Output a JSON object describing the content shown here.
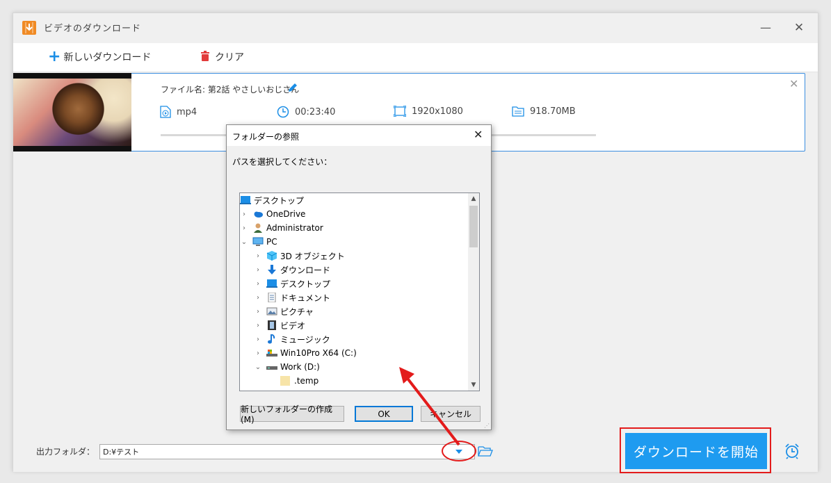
{
  "window": {
    "title": "ビデオのダウンロード",
    "minimize": "—",
    "close": "✕"
  },
  "toolbar": {
    "new_download_label": "新しいダウンロード",
    "clear_label": "クリア"
  },
  "download_item": {
    "file_name_label": "ファイル名: 第2話 やさしいおじさん",
    "format": "mp4",
    "duration": "00:23:40",
    "resolution": "1920x1080",
    "size": "918.70MB",
    "progress": 0.0
  },
  "bottom": {
    "output_folder_label": "出力フォルダ：",
    "output_folder_value": "D:¥テスト",
    "start_button_label": "ダウンロードを開始"
  },
  "dialog": {
    "title": "フォルダーの参照",
    "prompt": "パスを選択してください：",
    "tree": [
      {
        "label": "デスクトップ",
        "icon": "desktop-icon",
        "chevron": ""
      },
      {
        "label": "OneDrive",
        "icon": "cloud-icon",
        "chevron": ">"
      },
      {
        "label": "Administrator",
        "icon": "user-icon",
        "chevron": ">"
      },
      {
        "label": "PC",
        "icon": "pc-icon",
        "chevron": "v"
      },
      {
        "label": "3D オブジェクト",
        "icon": "cube-icon",
        "chevron": ">"
      },
      {
        "label": "ダウンロード",
        "icon": "download-arrow-icon",
        "chevron": ">"
      },
      {
        "label": "デスクトップ",
        "icon": "desktop-icon",
        "chevron": ">"
      },
      {
        "label": "ドキュメント",
        "icon": "document-icon",
        "chevron": ">"
      },
      {
        "label": "ピクチャ",
        "icon": "picture-icon",
        "chevron": ">"
      },
      {
        "label": "ビデオ",
        "icon": "film-icon",
        "chevron": ">"
      },
      {
        "label": "ミュージック",
        "icon": "music-note-icon",
        "chevron": ">"
      },
      {
        "label": "Win10Pro X64 (C:)",
        "icon": "system-drive-icon",
        "chevron": ">"
      },
      {
        "label": "Work (D:)",
        "icon": "drive-icon",
        "chevron": "v"
      },
      {
        "label": ".temp",
        "icon": "folder-icon",
        "chevron": ""
      }
    ],
    "new_folder_button": "新しいフォルダーの作成(M)",
    "ok_button": "OK",
    "cancel_button": "キャンセル"
  },
  "colors": {
    "accent": "#1e9bf0",
    "highlight_red": "#e31b1b",
    "item_border": "#3a8de0"
  }
}
